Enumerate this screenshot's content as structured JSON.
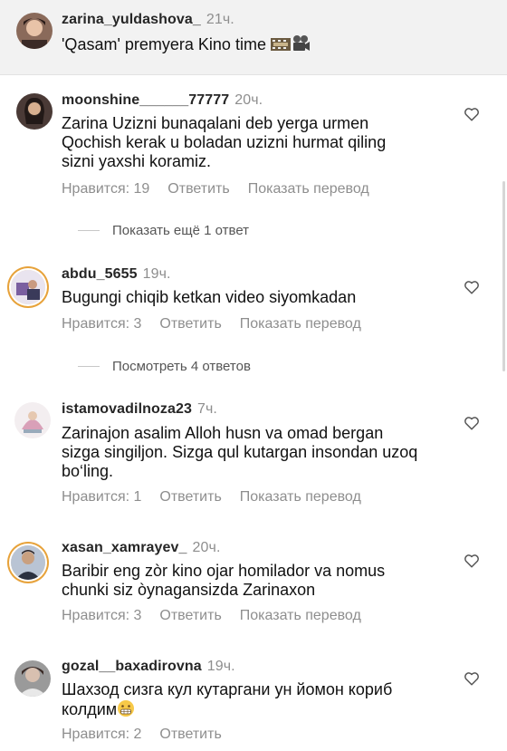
{
  "caption": {
    "username": "zarina_yuldashova_",
    "time": "21ч.",
    "text": "'Qasam' premyera Kino time"
  },
  "comments": [
    {
      "username": "moonshine______77777",
      "time": "20ч.",
      "lines": [
        "Zarina Uzizni bunaqalani deb yerga urmen",
        "Qochish kerak u boladan uzizni hurmat qiling",
        "sizni yaxshi koramiz."
      ],
      "likes": "Нравится: 19",
      "reply": "Ответить",
      "translate": "Показать перевод",
      "more_replies": "Показать ещё 1 ответ"
    },
    {
      "username": "abdu_5655",
      "time": "19ч.",
      "lines": [
        "Bugungi chiqib ketkan video siyomkadan"
      ],
      "likes": "Нравится: 3",
      "reply": "Ответить",
      "translate": "Показать перевод",
      "more_replies": "Посмотреть 4 ответов"
    },
    {
      "username": "istamovadilnoza23",
      "time": "7ч.",
      "lines": [
        "Zarinajon asalim Alloh husn va  omad bergan",
        "sizga singiljon. Sizga qul kutargan insondan uzoq",
        "bo‘ling."
      ],
      "likes": "Нравится: 1",
      "reply": "Ответить",
      "translate": "Показать перевод"
    },
    {
      "username": "xasan_xamrayev_",
      "time": "20ч.",
      "lines": [
        "Baribir eng zòr kino ojar homilador va nomus",
        "chunki siz òynagansizda Zarinaxon"
      ],
      "likes": "Нравится: 3",
      "reply": "Ответить",
      "translate": "Показать перевод"
    },
    {
      "username": "gozal__baxadirovna",
      "time": "19ч.",
      "lines": [
        "Шахзод сизга кул кутаргани ун йомон кориб",
        "колдим"
      ],
      "likes": "Нравится: 2",
      "reply": "Ответить"
    }
  ],
  "icons": {
    "heart": "heart-outline-icon",
    "film": "film-strip-icon",
    "camera": "movie-camera-icon",
    "grimace": "grimacing-face-icon"
  },
  "colors": {
    "meta_gray": "#8e8e8e",
    "story_ring": "#e7a23a",
    "caption_bg": "#f2f2f2"
  }
}
